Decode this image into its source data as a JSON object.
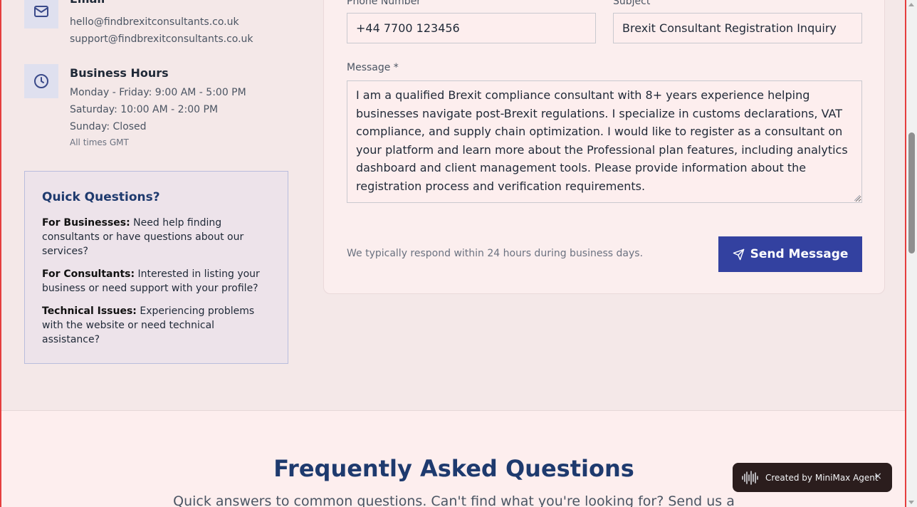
{
  "contact_info": {
    "email": {
      "title": "Email",
      "icon": "mail-icon",
      "lines": [
        "hello@findbrexitconsultants.co.uk",
        "support@findbrexitconsultants.co.uk"
      ]
    },
    "hours": {
      "title": "Business Hours",
      "icon": "clock-icon",
      "lines": [
        "Monday - Friday: 9:00 AM - 5:00 PM",
        "Saturday: 10:00 AM - 2:00 PM",
        "Sunday: Closed"
      ],
      "note": "All times GMT"
    }
  },
  "quick_questions": {
    "title": "Quick Questions?",
    "items": [
      {
        "label": "For Businesses:",
        "text": " Need help finding consultants or have questions about our services?"
      },
      {
        "label": "For Consultants:",
        "text": " Interested in listing your business or need support with your profile?"
      },
      {
        "label": "Technical Issues:",
        "text": " Experiencing problems with the website or need technical assistance?"
      }
    ]
  },
  "form": {
    "phone_label": "Phone Number",
    "phone_value": "+44 7700 123456",
    "subject_label": "Subject",
    "subject_value": "Brexit Consultant Registration Inquiry",
    "message_label": "Message *",
    "message_value": "I am a qualified Brexit compliance consultant with 8+ years experience helping businesses navigate post-Brexit regulations. I specialize in customs declarations, VAT compliance, and supply chain optimization. I would like to register as a consultant on your platform and learn more about the Professional plan features, including analytics dashboard and client management tools. Please provide information about the registration process and verification requirements.",
    "respond_note": "We typically respond within 24 hours during business days.",
    "send_label": "Send Message"
  },
  "faq": {
    "title": "Frequently Asked Questions",
    "subtitle": "Quick answers to common questions. Can't find what you're looking for? Send us a"
  },
  "badge": {
    "text": "Created by MiniMax Agent",
    "close": "×"
  },
  "colors": {
    "accent": "#3341a0",
    "heading": "#1e3a6e",
    "page_border": "#e53e3e"
  }
}
